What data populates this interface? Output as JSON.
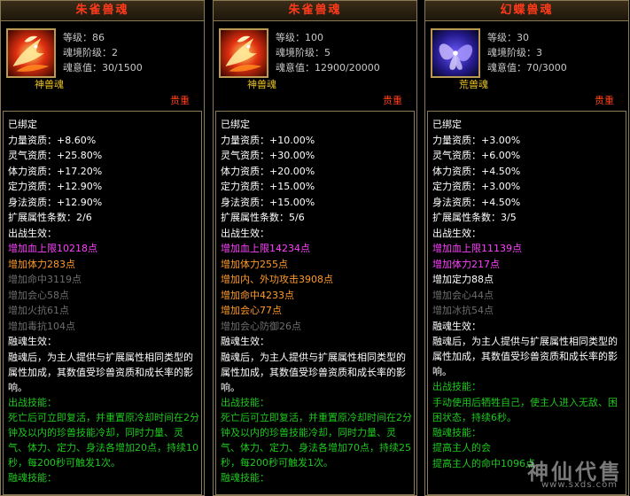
{
  "panels": [
    {
      "title": "朱雀兽魂",
      "level_label": "等级：",
      "level": "86",
      "tier_label": "魂境阶级：",
      "tier": "2",
      "will_label": "魂意值：",
      "will": "30/1500",
      "type": "神兽魂",
      "rarity": "贵重",
      "icon": "vermilion-bird-icon",
      "lines": [
        {
          "t": "已绑定",
          "c": "white"
        },
        {
          "t": "力量资质：+8.60%",
          "c": "white"
        },
        {
          "t": "灵气资质：+25.80%",
          "c": "white"
        },
        {
          "t": "体力资质：+17.20%",
          "c": "white"
        },
        {
          "t": "定力资质：+12.90%",
          "c": "white"
        },
        {
          "t": "身法资质：+12.90%",
          "c": "white"
        },
        {
          "t": "扩展属性条数：2/6",
          "c": "white"
        },
        {
          "t": "出战生效：",
          "c": "white"
        },
        {
          "t": "增加血上限10218点",
          "c": "pink"
        },
        {
          "t": "增加体力283点",
          "c": "orange"
        },
        {
          "t": "增加命中3119点",
          "c": "gray"
        },
        {
          "t": "增加会心58点",
          "c": "gray"
        },
        {
          "t": "增加火抗61点",
          "c": "gray"
        },
        {
          "t": "增加毒抗104点",
          "c": "gray"
        },
        {
          "t": "融魂生效：",
          "c": "white"
        },
        {
          "t": "融魂后，为主人提供与扩展属性相同类型的属性加成，其数值受珍兽资质和成长率的影响。",
          "c": "white",
          "wrap": true
        },
        {
          "t": "出战技能：",
          "c": "green"
        },
        {
          "t": "死亡后可立即复活，并重置原冷却时间在2分钟及以内的珍兽技能冷却，同时力量、灵气、体力、定力、身法各增加20点，持续10秒，每200秒可触发1次。",
          "c": "green",
          "wrap": true
        },
        {
          "t": "融魂技能：",
          "c": "green"
        }
      ]
    },
    {
      "title": "朱雀兽魂",
      "level_label": "等级：",
      "level": "100",
      "tier_label": "魂境阶级：",
      "tier": "5",
      "will_label": "魂意值：",
      "will": "12900/20000",
      "type": "神兽魂",
      "rarity": "贵重",
      "icon": "vermilion-bird-icon",
      "lines": [
        {
          "t": "已绑定",
          "c": "white"
        },
        {
          "t": "力量资质：+10.00%",
          "c": "white"
        },
        {
          "t": "灵气资质：+30.00%",
          "c": "white"
        },
        {
          "t": "体力资质：+20.00%",
          "c": "white"
        },
        {
          "t": "定力资质：+15.00%",
          "c": "white"
        },
        {
          "t": "身法资质：+15.00%",
          "c": "white"
        },
        {
          "t": "扩展属性条数：5/6",
          "c": "white"
        },
        {
          "t": "出战生效：",
          "c": "white"
        },
        {
          "t": "增加血上限14234点",
          "c": "pink"
        },
        {
          "t": "增加体力255点",
          "c": "orange"
        },
        {
          "t": "增加内、外功攻击3908点",
          "c": "orange"
        },
        {
          "t": "增加命中4233点",
          "c": "orange"
        },
        {
          "t": "增加会心77点",
          "c": "orange"
        },
        {
          "t": "增加会心防御26点",
          "c": "gray"
        },
        {
          "t": "融魂生效：",
          "c": "white"
        },
        {
          "t": "融魂后，为主人提供与扩展属性相同类型的属性加成，其数值受珍兽资质和成长率的影响。",
          "c": "white",
          "wrap": true
        },
        {
          "t": "出战技能：",
          "c": "green"
        },
        {
          "t": "死亡后可立即复活，并重置原冷却时间在2分钟及以内的珍兽技能冷却，同时力量、灵气、体力、定力、身法各增加70点，持续25秒，每200秒可触发1次。",
          "c": "green",
          "wrap": true
        },
        {
          "t": "融魂技能：",
          "c": "green"
        }
      ]
    },
    {
      "title": "幻蝶兽魂",
      "level_label": "等级：",
      "level": "30",
      "tier_label": "魂境阶级：",
      "tier": "3",
      "will_label": "魂意值：",
      "will": "70/3000",
      "type": "荒兽魂",
      "rarity": "贵重",
      "icon": "phantom-butterfly-icon",
      "lines": [
        {
          "t": "已绑定",
          "c": "white"
        },
        {
          "t": "力量资质：+3.00%",
          "c": "white"
        },
        {
          "t": "灵气资质：+6.00%",
          "c": "white"
        },
        {
          "t": "体力资质：+4.50%",
          "c": "white"
        },
        {
          "t": "定力资质：+3.00%",
          "c": "white"
        },
        {
          "t": "身法资质：+4.50%",
          "c": "white"
        },
        {
          "t": "扩展属性条数：3/5",
          "c": "white"
        },
        {
          "t": "出战生效：",
          "c": "white"
        },
        {
          "t": "增加血上限11139点",
          "c": "pink"
        },
        {
          "t": "增加体力217点",
          "c": "pink"
        },
        {
          "t": "增加定力88点",
          "c": "white"
        },
        {
          "t": "增加会心44点",
          "c": "gray"
        },
        {
          "t": "增加冰抗54点",
          "c": "gray"
        },
        {
          "t": "融魂生效：",
          "c": "white"
        },
        {
          "t": "融魂后，为主人提供与扩展属性相同类型的属性加成，其数值受珍兽资质和成长率的影响。",
          "c": "white",
          "wrap": true
        },
        {
          "t": "出战技能：",
          "c": "green"
        },
        {
          "t": "手动使用后牺牲自己，使主人进入无敌、困困状态，持续6秒。",
          "c": "green",
          "wrap": true
        },
        {
          "t": "融魂技能：",
          "c": "green"
        },
        {
          "t": "提高主人的会",
          "c": "green"
        },
        {
          "t": "提高主人的命中1096点",
          "c": "green"
        }
      ]
    }
  ],
  "watermark": {
    "main": "神仙代售",
    "sub": "www.sxds.com"
  }
}
